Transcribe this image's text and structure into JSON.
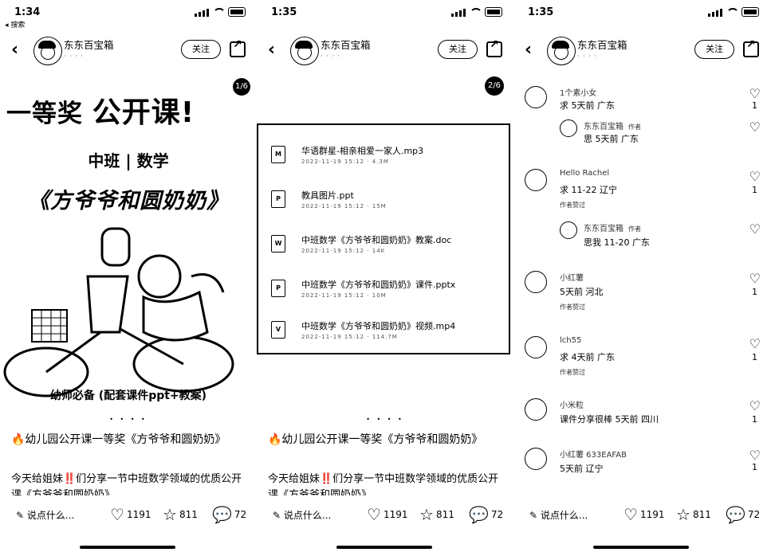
{
  "screens": [
    {
      "time": "1:34",
      "back_to": "◂ 搜索",
      "author": "东东百宝箱",
      "follow": "关注",
      "cover": {
        "badge": "1/6",
        "title_prefix": "一等奖",
        "title_main": "公开课!",
        "subtitle": "中班 | 数学",
        "book_title": "《方爷爷和圆奶奶》",
        "footer": "幼师必备 (配套课件ppt+教案)"
      },
      "dots": "• • • •",
      "post_title": "🔥幼儿园公开课一等奖《方爷爷和圆奶奶》",
      "post_body": "今天给姐妹‼️们分享一节中班数学领域的优质公开课《方爷爷和圆奶奶》",
      "comment_placeholder": "说点什么...",
      "likes": "1191",
      "stars": "811",
      "comments": "72"
    },
    {
      "time": "1:35",
      "author": "东东百宝箱",
      "follow": "关注",
      "badge": "2/6",
      "files": [
        {
          "name": "华语群星-相亲相爱一家人.mp3",
          "meta": "2022-11-19 15:12 · 4.3M",
          "icon": "M"
        },
        {
          "name": "教具图片.ppt",
          "meta": "2022-11-19 15:12 · 15M",
          "icon": "P"
        },
        {
          "name": "中班数学《方爷爷和圆奶奶》教案.doc",
          "meta": "2022-11-19 15:12 · 14K",
          "icon": "W"
        },
        {
          "name": "中班数学《方爷爷和圆奶奶》课件.pptx",
          "meta": "2022-11-19 15:12 · 10M",
          "icon": "P"
        },
        {
          "name": "中班数学《方爷爷和圆奶奶》视频.mp4",
          "meta": "2022-11-19 15:12 · 114.7M",
          "icon": "V"
        }
      ],
      "dots": "• • • •",
      "post_title": "🔥幼儿园公开课一等奖《方爷爷和圆奶奶》",
      "post_body": "今天给姐妹‼️们分享一节中班数学领域的优质公开课《方爷爷和圆奶奶》",
      "comment_placeholder": "说点什么...",
      "likes": "1191",
      "stars": "811",
      "comments": "72"
    },
    {
      "time": "1:35",
      "author": "东东百宝箱",
      "follow": "关注",
      "comments_list": [
        {
          "name": "1个素小女",
          "text": "求 5天前 广东",
          "likes": "1"
        },
        {
          "name": "东东百宝箱",
          "author_label": "作者",
          "text": "思 5天前 广东",
          "reply": true
        },
        {
          "name": "Hello Rachel",
          "text": "求 11-22 辽宁",
          "likes": "1",
          "tag": "作者赞过"
        },
        {
          "name": "东东百宝箱",
          "author_label": "作者",
          "text": "思我 11-20 广东",
          "reply": true
        },
        {
          "name": "小红薯",
          "text": "5天前 河北",
          "likes": "1",
          "tag": "作者赞过"
        },
        {
          "name": "lch55",
          "text": "求 4天前 广东",
          "likes": "1",
          "tag": "作者赞过"
        },
        {
          "name": "小米粒",
          "text": "课件分享很棒 5天前 四川",
          "likes": "1"
        },
        {
          "name": "小红薯 633EAFAB",
          "text": "5天前 辽宁",
          "likes": "1"
        }
      ],
      "comment_placeholder": "说点什么...",
      "likes": "1191",
      "stars": "811",
      "comments": "72"
    }
  ]
}
